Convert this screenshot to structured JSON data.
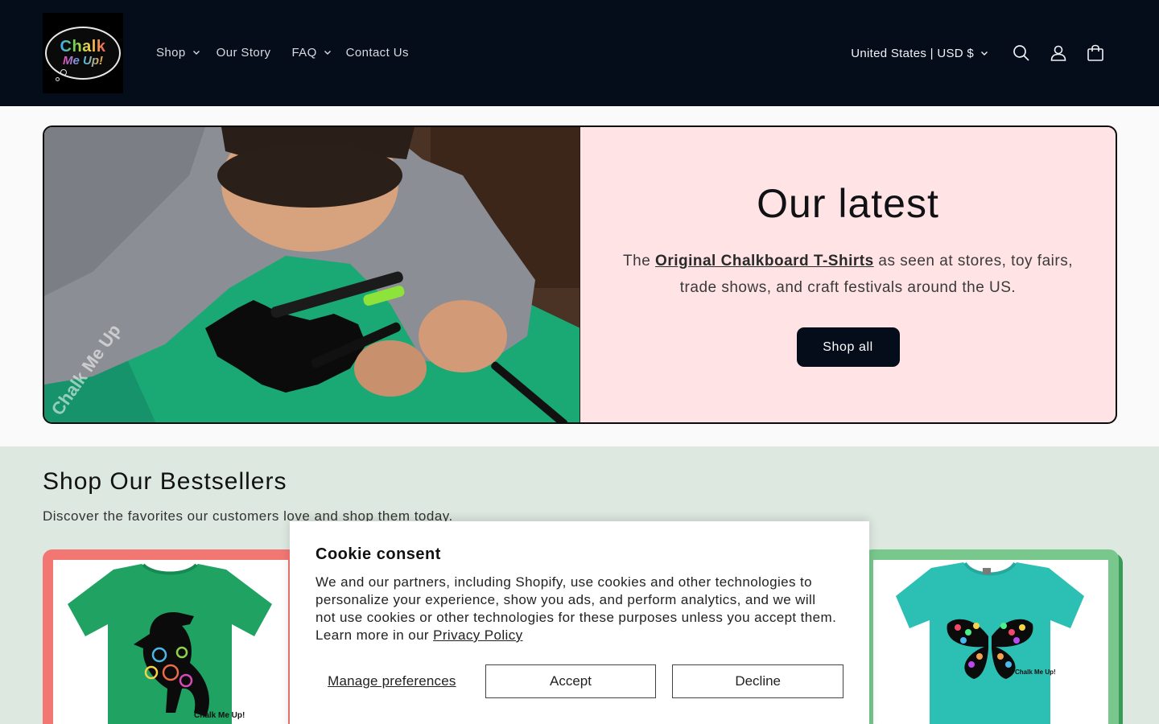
{
  "header": {
    "logo": {
      "line1": "Chalk",
      "line2": "Me Up!"
    },
    "nav": [
      {
        "label": "Shop",
        "has_dropdown": true
      },
      {
        "label": "Our Story",
        "has_dropdown": false
      },
      {
        "label": "FAQ",
        "has_dropdown": true
      },
      {
        "label": "Contact Us",
        "has_dropdown": false
      }
    ],
    "country_selector": "United States | USD $",
    "icons": [
      "search-icon",
      "account-icon",
      "cart-icon"
    ]
  },
  "hero": {
    "title": "Our latest",
    "desc_prefix": "The ",
    "desc_link": "Original Chalkboard T-Shirts",
    "desc_suffix": " as seen at stores, toy fairs, trade shows, and craft festivals around the US.",
    "cta_label": "Shop all",
    "image_text": "Chalk Me Up"
  },
  "bestsellers": {
    "title": "Shop Our Bestsellers",
    "subtitle": "Discover the favorites our customers love and shop them today.",
    "products": [
      {
        "name": "dinosaur-tshirt",
        "shirt_color": "#1fa262",
        "print_label": "Chalk Me Up!"
      },
      {
        "name": "butterfly-tshirt",
        "shirt_color": "#2cc0b4",
        "print_label": "Chalk Me Up!"
      }
    ]
  },
  "cookie": {
    "title": "Cookie consent",
    "text": "We and our partners, including Shopify, use cookies and other technologies to personalize your experience, show you ads, and perform analytics, and we will not use cookies or other technologies for these purposes unless you accept them. Learn more in our ",
    "policy_link": "Privacy Policy",
    "manage_label": "Manage preferences",
    "accept_label": "Accept",
    "decline_label": "Decline"
  },
  "colors": {
    "header_bg": "#050d1b",
    "hero_bg": "#ffe3e5",
    "section_bg": "#dce8e0",
    "card_left": "#f27773",
    "card_right": "#78c88d"
  }
}
